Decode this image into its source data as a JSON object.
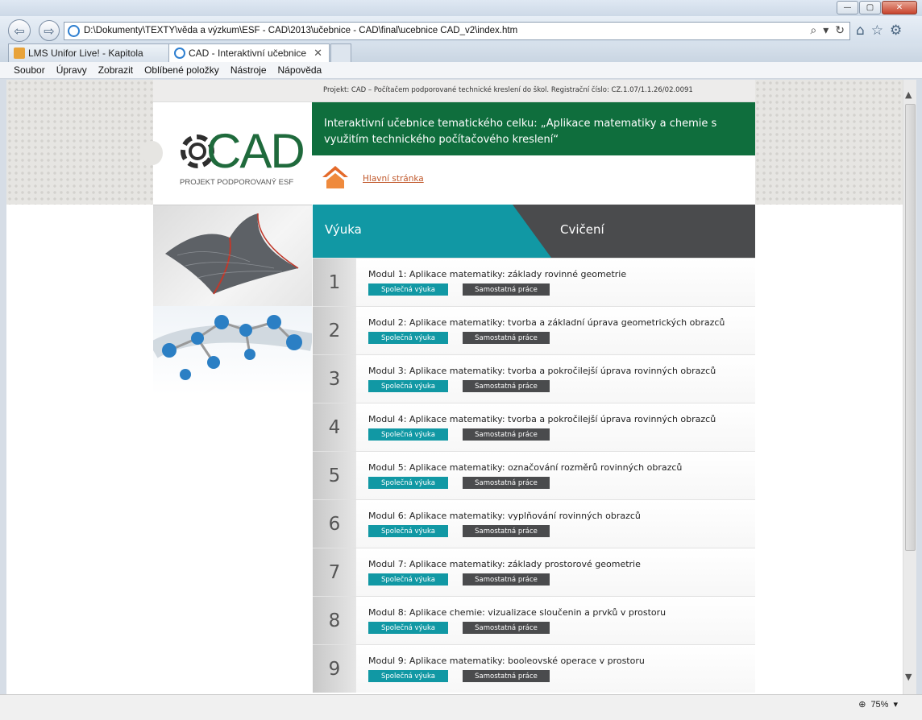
{
  "browser": {
    "address": "D:\\Dokumenty\\TEXTY\\věda a výzkum\\ESF - CAD\\2013\\učebnice - CAD\\final\\ucebnice CAD_v2\\index.htm",
    "tabs": [
      {
        "label": "LMS Unifor Live! - Kapitola"
      },
      {
        "label": "CAD - Interaktivní učebnice"
      }
    ],
    "menu": [
      "Soubor",
      "Úpravy",
      "Zobrazit",
      "Oblíbené položky",
      "Nástroje",
      "Nápověda"
    ],
    "zoom": "75%"
  },
  "page": {
    "project_text": "Projekt: CAD – Počítačem podporované technické kreslení do škol. Registrační číslo: CZ.1.07/1.1.26/02.0091",
    "logo_text": "CAD",
    "logo_subtitle": "PROJEKT PODPOROVANÝ ESF",
    "banner_text": "Interaktivní učebnice tematického celku: „Aplikace matematiky a chemie s využitím technického počítačového kreslení“",
    "home_link": "Hlavní stránka",
    "tab_vyuka": "Výuka",
    "tab_cviceni": "Cvičení",
    "btn_spolecna": "Společná výuka",
    "btn_samostatna": "Samostatná práce",
    "modules": [
      {
        "num": "1",
        "title": "Modul 1: Aplikace matematiky: základy rovinné geometrie"
      },
      {
        "num": "2",
        "title": "Modul 2: Aplikace matematiky: tvorba a základní úprava geometrických obrazců"
      },
      {
        "num": "3",
        "title": "Modul 3: Aplikace matematiky: tvorba a pokročilejší úprava rovinných obrazců"
      },
      {
        "num": "4",
        "title": "Modul 4: Aplikace matematiky: tvorba a pokročilejší úprava rovinných obrazců"
      },
      {
        "num": "5",
        "title": "Modul 5: Aplikace matematiky: označování rozměrů rovinných obrazců"
      },
      {
        "num": "6",
        "title": "Modul 6: Aplikace matematiky: vyplňování rovinných obrazců"
      },
      {
        "num": "7",
        "title": "Modul 7: Aplikace matematiky: základy prostorové geometrie"
      },
      {
        "num": "8",
        "title": "Modul 8: Aplikace chemie: vizualizace sloučenin a prvků v prostoru"
      },
      {
        "num": "9",
        "title": "Modul 9: Aplikace matematiky: booleovské operace v prostoru"
      }
    ]
  },
  "colors": {
    "green": "#0f6e3d",
    "teal": "#1198a4",
    "dark": "#4a4b4d"
  }
}
